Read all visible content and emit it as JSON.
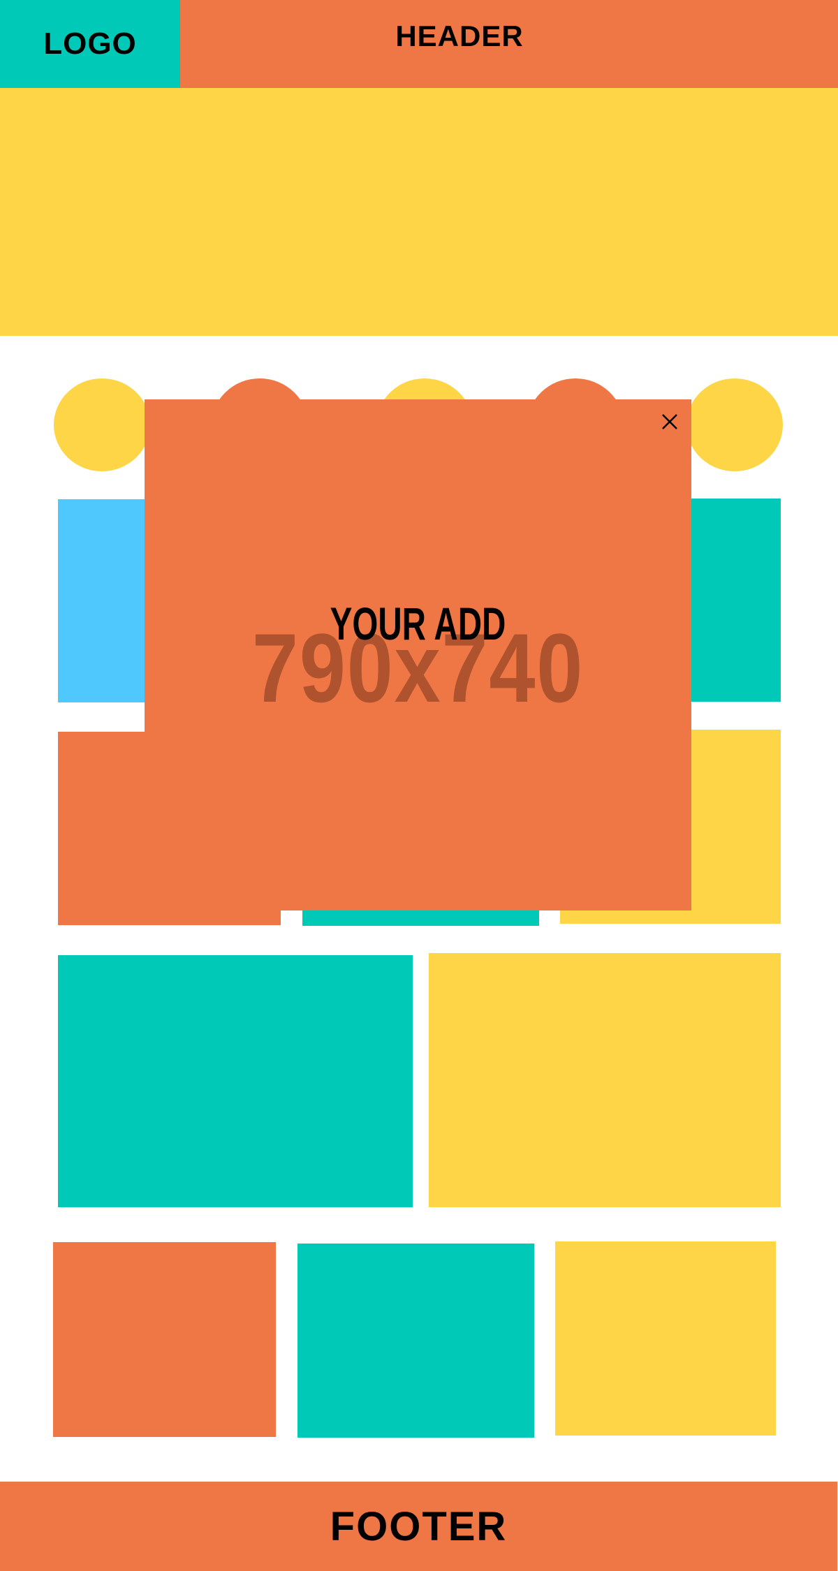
{
  "header": {
    "logo": "LOGO",
    "title": "HEADER"
  },
  "ad_modal": {
    "title": "YOUR ADD",
    "size": "790x740",
    "close_icon": "close-icon"
  },
  "footer": {
    "label": "FOOTER"
  },
  "colors": {
    "orange": "#ef7645",
    "teal": "#00c9b7",
    "yellow": "#fdd547",
    "blue": "#4fc9fd",
    "ad_text": "#af532f"
  }
}
